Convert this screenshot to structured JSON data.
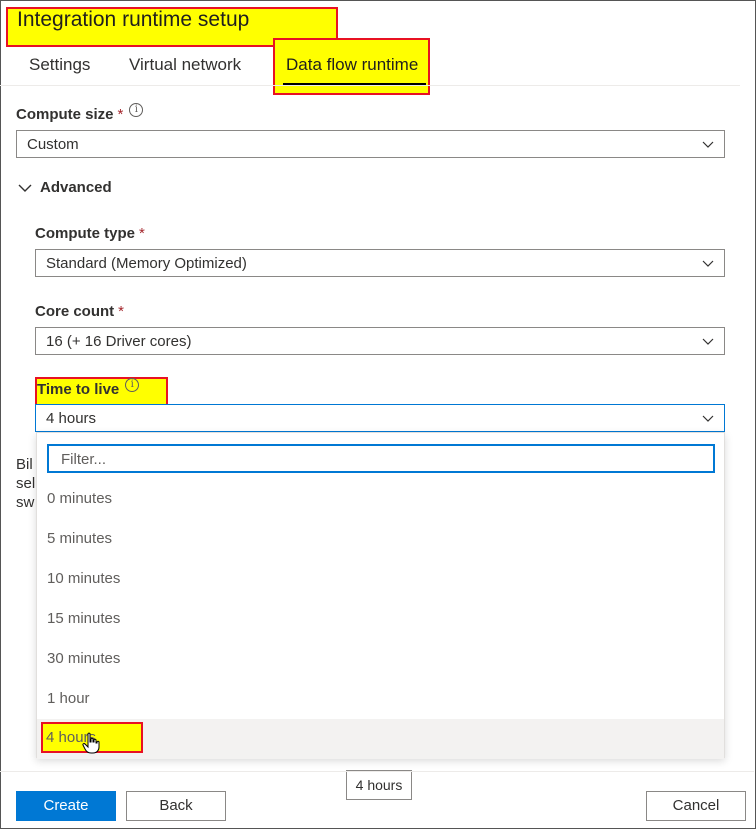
{
  "header": {
    "title": "Integration runtime setup"
  },
  "tabs": [
    {
      "label": "Settings"
    },
    {
      "label": "Virtual network"
    },
    {
      "label": "Data flow runtime"
    }
  ],
  "compute_size": {
    "label": "Compute size",
    "required": "*",
    "value": "Custom"
  },
  "advanced": {
    "label": "Advanced"
  },
  "compute_type": {
    "label": "Compute type",
    "required": "*",
    "value": "Standard (Memory Optimized)"
  },
  "core_count": {
    "label": "Core count",
    "required": "*",
    "value": "16 (+ 16 Driver cores)"
  },
  "time_to_live": {
    "label": "Time to live",
    "value": "4 hours",
    "filter_placeholder": "Filter...",
    "options": [
      "0 minutes",
      "5 minutes",
      "10 minutes",
      "15 minutes",
      "30 minutes",
      "1 hour",
      "4 hours"
    ],
    "selected": "4 hours",
    "tooltip": "4 hours"
  },
  "billing_text": [
    "Bil",
    "sel",
    "sw"
  ],
  "footer": {
    "create": "Create",
    "back": "Back",
    "cancel": "Cancel"
  },
  "colors": {
    "accent": "#0078d4",
    "highlight": "#ffff00",
    "highlight_border": "#e81123"
  }
}
